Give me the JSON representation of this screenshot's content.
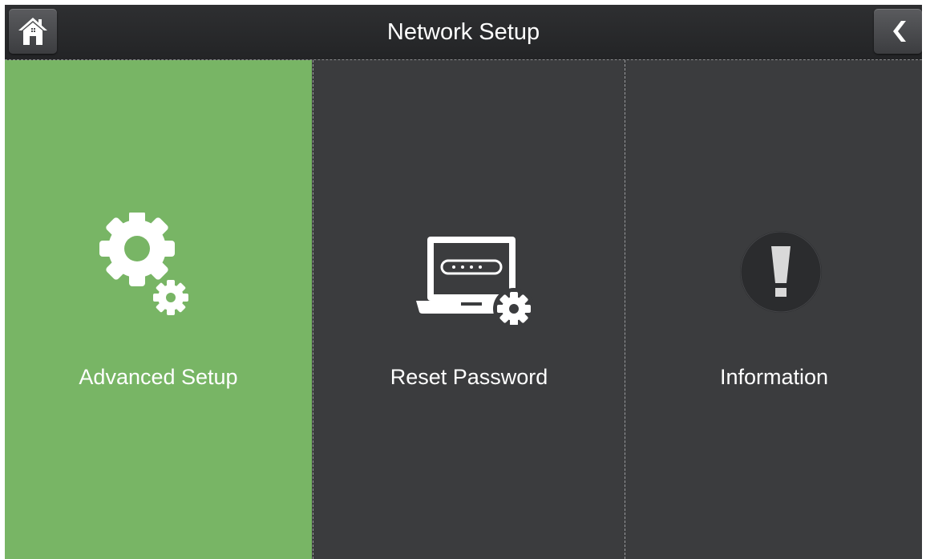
{
  "header": {
    "title": "Network Setup"
  },
  "icons": {
    "home": "home-icon",
    "back": "chevron-left-icon"
  },
  "tiles": [
    {
      "label": "Advanced Setup",
      "icon": "gears-icon",
      "selected": true
    },
    {
      "label": "Reset Password",
      "icon": "laptop-password-gear-icon",
      "selected": false
    },
    {
      "label": "Information",
      "icon": "exclamation-icon",
      "selected": false
    }
  ],
  "colors": {
    "selected_tile": "#78b565",
    "tile_background": "#3b3c3e",
    "header_background": "#262729",
    "text": "#ffffff"
  }
}
